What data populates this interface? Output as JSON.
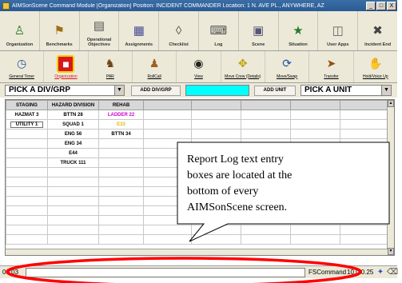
{
  "window": {
    "title": "AIMSonScene Command Module [Organization] Position: INCIDENT COMMANDER Location: 1 N. AVE PL., ANYWHERE, AZ",
    "minimize": "_",
    "maximize": "□",
    "close": "X"
  },
  "toolbar_main": [
    {
      "label": "Organization",
      "icon": "people-icon"
    },
    {
      "label": "Benchmarks",
      "icon": "benchmark-icon"
    },
    {
      "label": "Operational Objectives",
      "icon": "objectives-icon"
    },
    {
      "label": "Assignments",
      "icon": "assignments-icon"
    },
    {
      "label": "Checklist",
      "icon": "checklist-icon"
    },
    {
      "label": "Log",
      "icon": "log-icon"
    },
    {
      "label": "Scene",
      "icon": "scene-icon"
    },
    {
      "label": "Situation",
      "icon": "situation-icon"
    },
    {
      "label": "User Apps",
      "icon": "user-apps-icon"
    },
    {
      "label": "Incident End",
      "icon": "incident-end-icon"
    }
  ],
  "toolbar_secondary": [
    {
      "label": "General Timer",
      "icon": "timer-icon"
    },
    {
      "label": "Organization",
      "icon": "organization-icon",
      "active": true
    },
    {
      "label": "PAR",
      "icon": "par-icon"
    },
    {
      "label": "RollCall",
      "icon": "rollcall-icon"
    },
    {
      "label": "View",
      "icon": "view-icon"
    },
    {
      "label": "Move Crew (Details)",
      "icon": "move-crew-icon"
    },
    {
      "label": "Move/Swap",
      "icon": "move-swap-icon"
    },
    {
      "label": "Transfer",
      "icon": "transfer-icon"
    },
    {
      "label": "Hold/Voice Up",
      "icon": "hold-voice-icon"
    }
  ],
  "controls": {
    "pick_group": "PICK A DIV/GRP",
    "add_div_grp": "ADD DIV/GRP",
    "add_unit": "ADD UNIT",
    "pick_unit": "PICK A UNIT"
  },
  "grid": {
    "headers": [
      "STAGING",
      "HAZARD DIVISION",
      "REHAB",
      "",
      "",
      "",
      "",
      ""
    ],
    "rows": [
      [
        "HAZMAT 3",
        "BTTN 28",
        "LADDER 22",
        "",
        "",
        "",
        "",
        ""
      ],
      [
        "UTILITY 1",
        "SQUAD 1",
        "E33",
        "",
        "",
        "",
        "",
        ""
      ],
      [
        "",
        "ENG 56",
        "BTTN 34",
        "",
        "",
        "",
        "",
        ""
      ],
      [
        "",
        "ENG 34",
        "",
        "",
        "",
        "",
        "",
        ""
      ],
      [
        "",
        "E44",
        "",
        "",
        "",
        "",
        "",
        ""
      ],
      [
        "",
        "TRUCK 111",
        "",
        "",
        "",
        "",
        "",
        ""
      ],
      [
        "",
        "",
        "",
        "",
        "",
        "",
        "",
        ""
      ],
      [
        "",
        "",
        "",
        "",
        "",
        "",
        "",
        ""
      ],
      [
        "",
        "",
        "",
        "",
        "",
        "",
        "",
        ""
      ],
      [
        "",
        "",
        "",
        "",
        "",
        "",
        "",
        ""
      ],
      [
        "",
        "",
        "",
        "",
        "",
        "",
        "",
        ""
      ],
      [
        "",
        "",
        "",
        "",
        "",
        "",
        "",
        ""
      ],
      [
        "",
        "",
        "",
        "",
        "",
        "",
        "",
        ""
      ],
      [
        "",
        "",
        "",
        "",
        "",
        "",
        "",
        ""
      ]
    ],
    "cell_colors": {
      "LADDER 22": "#cc00cc",
      "E33": "#e6b800"
    }
  },
  "callout": {
    "lines": [
      "Report Log text entry",
      "boxes are located at the",
      "bottom of every",
      "AIMSonScene screen."
    ]
  },
  "status": {
    "time": "00:03",
    "command": "FSCommand",
    "version": "10.0.0.25"
  }
}
